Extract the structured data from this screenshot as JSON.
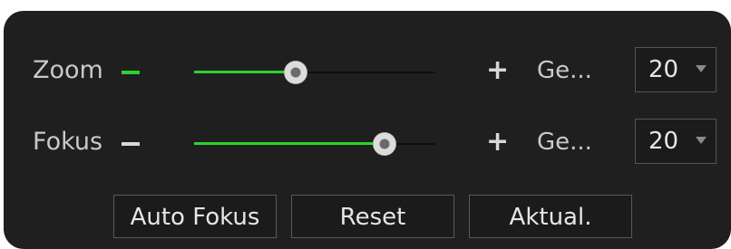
{
  "zoom": {
    "label": "Zoom",
    "minus_icon": "minus-icon",
    "plus_icon": "plus-icon",
    "slider_percent": 42,
    "speed_label": "Ge...",
    "speed_value": "20",
    "minus_color": "#2fd12f"
  },
  "focus": {
    "label": "Fokus",
    "minus_icon": "minus-icon",
    "plus_icon": "plus-icon",
    "slider_percent": 79,
    "speed_label": "Ge...",
    "speed_value": "20",
    "minus_color": "#d8d8d8"
  },
  "buttons": {
    "auto_focus": "Auto Fokus",
    "reset": "Reset",
    "refresh": "Aktual."
  },
  "colors": {
    "accent": "#2fd12f",
    "panel_bg": "#1f1f1f"
  }
}
